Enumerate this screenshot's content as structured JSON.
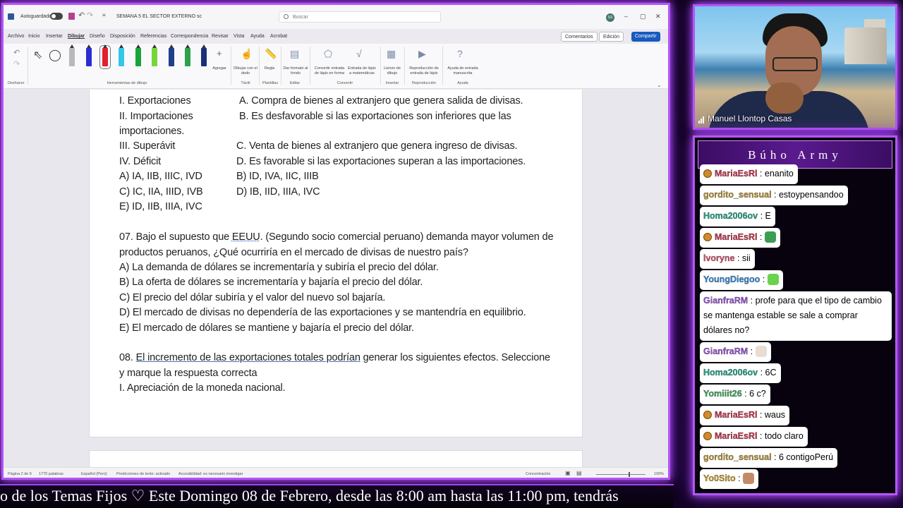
{
  "word": {
    "titlebar": {
      "autosave_label": "Autoguardado",
      "title": "SEMANA 5 EL SECTOR EXTERNO sc",
      "search_placeholder": "Buscar",
      "avatar_initials": "SS"
    },
    "menu_tabs": [
      "Archivo",
      "Inicio",
      "Insertar",
      "Dibujar",
      "Diseño",
      "Disposición",
      "Referencias",
      "Correspondencia",
      "Revisar",
      "Vista",
      "Ayuda",
      "Acrobat"
    ],
    "buttons": {
      "comments": "Comentarios",
      "editing": "Edición",
      "share": "Compartir"
    },
    "ribbon": {
      "deshacer": "Deshacer",
      "tools_group": "Herramientas de dibujo",
      "agregar": "Agregar",
      "dibujar_dedo": "Dibujar con el dedo",
      "tactil": "Táctil",
      "regla": "Regla",
      "plantillas": "Plantillas",
      "dar_formato": "Dar formato al fondo",
      "editar": "Editar",
      "convertir_forma": "Convertir entrada de lápiz en forma",
      "entrada_matematicas": "Entrada de lápiz a matemáticas",
      "convertir": "Convertir",
      "lienzo": "Lienzo de dibujo",
      "insertar": "Insertar",
      "reproduccion_entrada": "Reproducción de entrada de lápiz",
      "reproduccion": "Reproducción",
      "ayuda_manuscrita": "Ayuda de entrada manuscrita",
      "ayuda": "Ayuda"
    },
    "document": {
      "q6": {
        "left": [
          "I. Exportaciones",
          "II. Importaciones",
          "importaciones.",
          "III. Superávit",
          "IV. Déficit"
        ],
        "right": [
          "A. Compra de bienes al extranjero que genera salida de divisas.",
          "B.  Es  desfavorable  si  las  exportaciones  son  inferiores  que  las",
          "C. Venta de bienes al extranjero que genera ingreso de divisas.",
          "D. Es favorable si las exportaciones superan a las importaciones."
        ],
        "options_left": [
          "A) IA, IIB, IIIC, IVD",
          "C) IC, IIA, IIID, IVB",
          "E) ID, IIB, IIIA, IVC"
        ],
        "options_right": [
          "B) ID, IVA, IIC, IIIB",
          "D) IB, IID, IIIA, IVC"
        ]
      },
      "q7": {
        "line1a": "07. Bajo el supuesto que ",
        "line1b": "EEUU",
        "line1c": ". (Segundo socio comercial peruano) demanda mayor volumen de",
        "line2": "productos peruanos, ¿Qué ocurriría en el mercado de divisas de nuestro país?",
        "options": [
          "A) La demanda de dólares se incrementaría y subiría el precio del dólar.",
          "B) La oferta de dólares se incrementaría y bajaría el precio del dólar.",
          "C) El precio del dólar subiría y el valor del nuevo sol bajaría.",
          "D) El mercado de divisas no dependería de las exportaciones y se mantendría en equilibrio.",
          "E) El mercado de dólares se mantiene y bajaría el precio del dólar."
        ]
      },
      "q8": {
        "prefix": "08. ",
        "underlined": "El incremento de las exportaciones totales podrían",
        "rest": " generar los siguientes efectos. Seleccione",
        "line2": "y marque la respuesta correcta",
        "line3": "I. Apreciación de la moneda nacional."
      }
    },
    "status": {
      "page": "Página 2 de 5",
      "words": "1770 palabras",
      "language": "Español (Perú)",
      "predictions": "Predicciones de texto: activado",
      "accessibility": "Accesibilidad: es necesario investigar",
      "focus": "Concentración",
      "zoom": "100%"
    }
  },
  "webcam": {
    "name": "Manuel Llontop Casas"
  },
  "chat": {
    "title": "Búho Army",
    "messages": [
      {
        "user": "MariaEsRl",
        "text": "enanito",
        "badge": true,
        "color": "#cc2f4a"
      },
      {
        "user": "gordito_sensual",
        "text": "estoypensandoo",
        "badge": false,
        "color": "#b8912a"
      },
      {
        "user": "Homa2006ov",
        "text": "E",
        "badge": false,
        "color": "#1ea68a"
      },
      {
        "user": "MariaEsRl",
        "text": "",
        "badge": true,
        "color": "#cc2f4a",
        "emote": "#3d9e52"
      },
      {
        "user": "lvoryne",
        "text": "sii",
        "badge": false,
        "color": "#d4506a"
      },
      {
        "user": "YoungDiegoo",
        "text": "",
        "badge": false,
        "color": "#2f8ad6",
        "emote": "#6ad24c"
      },
      {
        "user": "GianfraRM",
        "text": "profe para que el tipo de cambio se mantenga estable se sale a comprar dólares no?",
        "badge": false,
        "color": "#9c4fd6"
      },
      {
        "user": "GianfraRM",
        "text": "",
        "badge": false,
        "color": "#9c4fd6",
        "emote": "#e8ddd0"
      },
      {
        "user": "Homa2006ov",
        "text": "6C",
        "badge": false,
        "color": "#1ea68a"
      },
      {
        "user": "Yomiiit26",
        "text": "6 c?",
        "badge": false,
        "color": "#3aa85a"
      },
      {
        "user": "MariaEsRl",
        "text": "waus",
        "badge": true,
        "color": "#cc2f4a"
      },
      {
        "user": "MariaEsRl",
        "text": "todo claro",
        "badge": true,
        "color": "#cc2f4a"
      },
      {
        "user": "gordito_sensual",
        "text": "6 contigoPerú",
        "badge": false,
        "color": "#b8912a"
      },
      {
        "user": "Yo0Sito",
        "text": "",
        "badge": false,
        "color": "#c99a24",
        "emote": "#c48a66"
      }
    ]
  },
  "ticker": {
    "text": "o de los Temas Fijos ♡  Este Domingo 08 de Febrero, desde las 8:00 am hasta las 11:00 pm, tendrás"
  }
}
